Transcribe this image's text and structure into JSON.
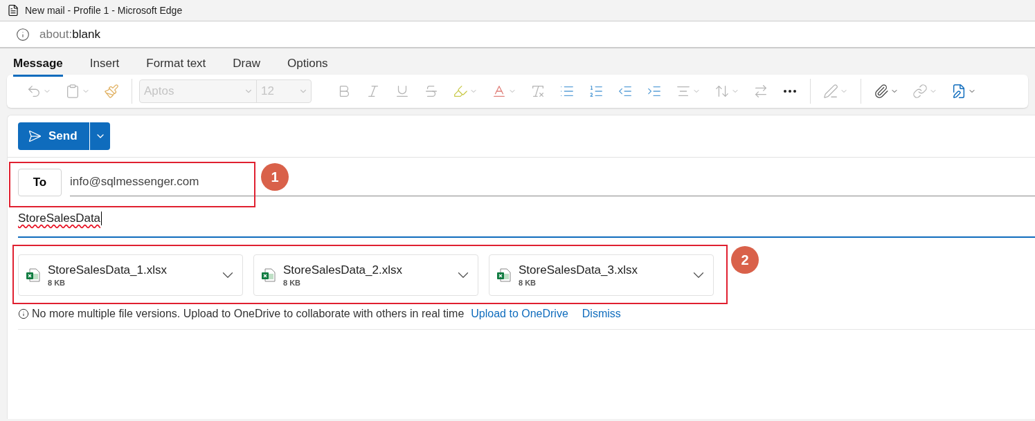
{
  "window": {
    "title": "New mail - Profile 1 - Microsoft Edge"
  },
  "address_bar": {
    "prefix": "about:",
    "value": "blank"
  },
  "tabs": [
    {
      "label": "Message",
      "selected": true
    },
    {
      "label": "Insert",
      "selected": false
    },
    {
      "label": "Format text",
      "selected": false
    },
    {
      "label": "Draw",
      "selected": false
    },
    {
      "label": "Options",
      "selected": false
    }
  ],
  "toolbar": {
    "font": "Aptos",
    "size": "12",
    "formatting_disabled": true
  },
  "compose": {
    "send_label": "Send",
    "to_label": "To",
    "to_value": "info@sqlmessenger.com",
    "subject": "StoreSalesData",
    "subject_misspelled": true,
    "attachments": [
      {
        "name": "StoreSalesData_1.xlsx",
        "size": "8 KB"
      },
      {
        "name": "StoreSalesData_2.xlsx",
        "size": "8 KB"
      },
      {
        "name": "StoreSalesData_3.xlsx",
        "size": "8 KB"
      }
    ],
    "notice": {
      "text": "No more multiple file versions. Upload to OneDrive to collaborate with others in real time",
      "link": "Upload to OneDrive",
      "dismiss": "Dismiss"
    }
  },
  "annotations": [
    {
      "label": "1"
    },
    {
      "label": "2"
    }
  ]
}
